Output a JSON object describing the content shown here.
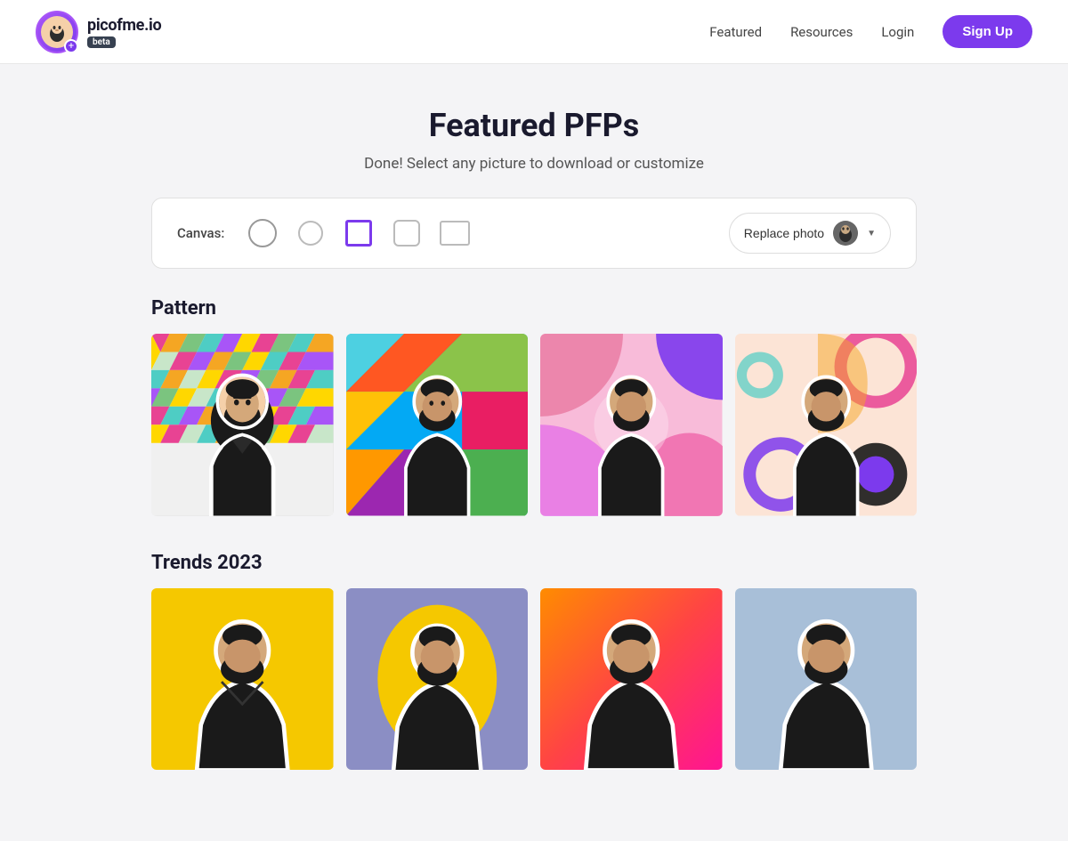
{
  "header": {
    "brand": "picofme.io",
    "beta_label": "beta",
    "nav": {
      "featured": "Featured",
      "resources": "Resources",
      "login": "Login",
      "signup": "Sign Up"
    },
    "avatar_emoji": "😊"
  },
  "hero": {
    "title": "Featured PFPs",
    "subtitle": "Done! Select any picture to download or customize"
  },
  "toolbar": {
    "canvas_label": "Canvas:",
    "replace_label": "Replace photo",
    "shapes": [
      "circle",
      "circle-sm",
      "square-active",
      "square-rounded",
      "rect"
    ]
  },
  "sections": [
    {
      "id": "pattern",
      "title": "Pattern",
      "cards": [
        {
          "id": "p1",
          "bg": "pattern-1"
        },
        {
          "id": "p2",
          "bg": "pattern-2"
        },
        {
          "id": "p3",
          "bg": "pattern-3"
        },
        {
          "id": "p4",
          "bg": "pattern-4-bauhaus"
        }
      ]
    },
    {
      "id": "trends",
      "title": "Trends 2023",
      "cards": [
        {
          "id": "t1",
          "bg": "trend-yellow"
        },
        {
          "id": "t2",
          "bg": "trend-lavender"
        },
        {
          "id": "t3",
          "bg": "trend-orange"
        },
        {
          "id": "t4",
          "bg": "trend-blue"
        }
      ]
    }
  ],
  "colors": {
    "brand": "#7c3aed",
    "brand_light": "#a855f7"
  }
}
